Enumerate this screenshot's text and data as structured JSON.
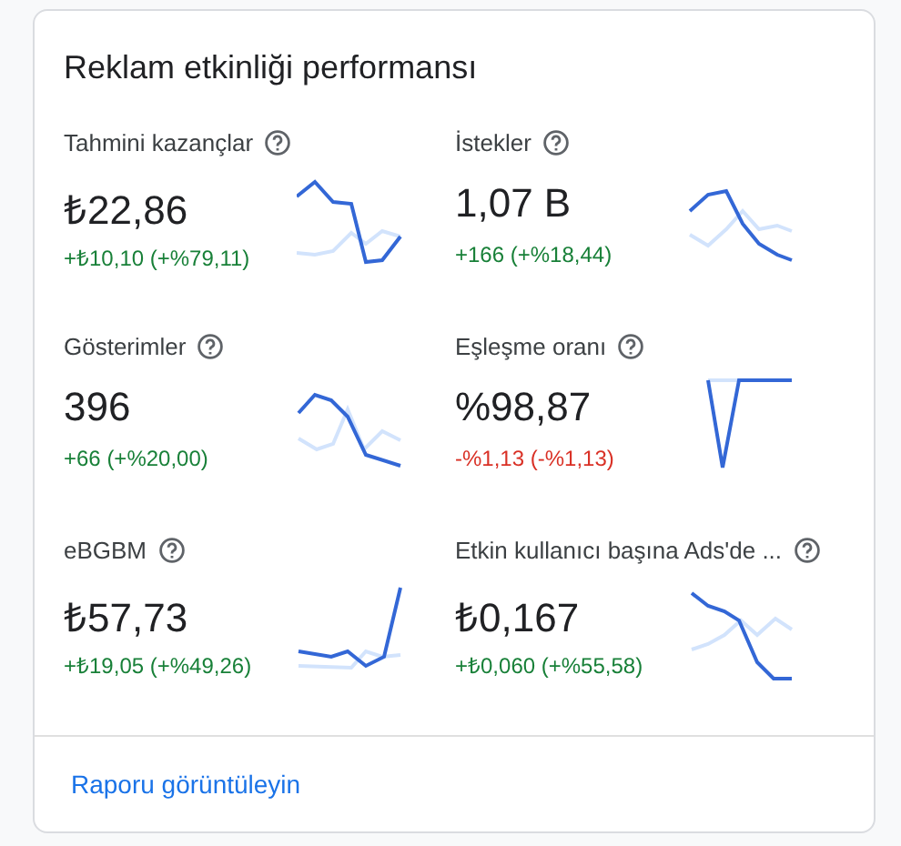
{
  "card": {
    "title": "Reklam etkinliği performansı",
    "metrics": [
      {
        "label": "Tahmini kazançlar",
        "value": "₺22,86",
        "change": "+₺10,10 (+%79,11)",
        "color": "#188038"
      },
      {
        "label": "İstekler",
        "value": "1,07 B",
        "change": "+166 (+%18,44)",
        "color": "#188038"
      },
      {
        "label": "Gösterimler",
        "value": "396",
        "change": "+66 (+%20,00)",
        "color": "#188038"
      },
      {
        "label": "Eşleşme oranı",
        "value": "%98,87",
        "change": "-%1,13 (-%1,13)",
        "color": "#d93025"
      },
      {
        "label": "eBGBM",
        "value": "₺57,73",
        "change": "+₺19,05 (+%49,26)",
        "color": "#188038"
      },
      {
        "label": "Etkin kullanıcı başına Ads'de ...",
        "value": "₺0,167",
        "change": "+₺0,060 (+%55,58)",
        "color": "#188038"
      }
    ],
    "link": "Raporu görüntüleyin"
  }
}
